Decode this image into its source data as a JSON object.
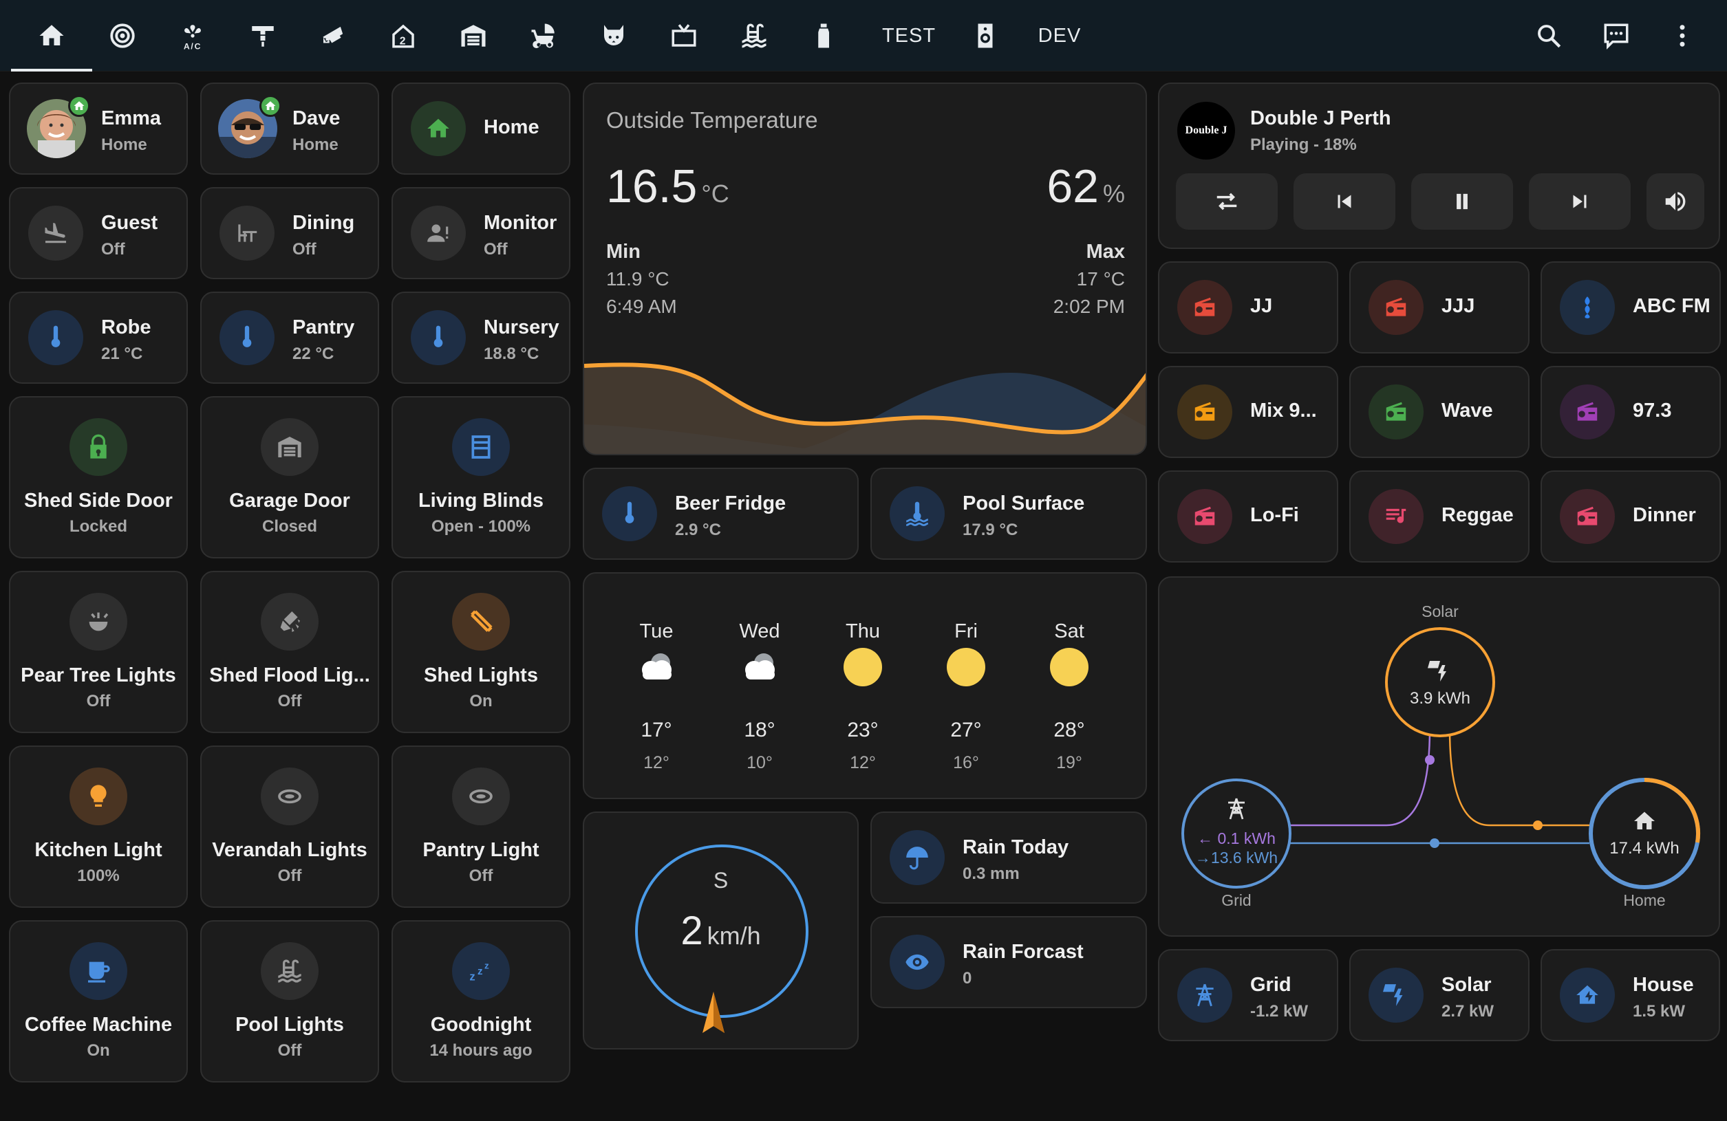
{
  "nav": {
    "tabs": [
      {
        "icon": "home-icon",
        "selected": true
      },
      {
        "icon": "camera-ring-icon"
      },
      {
        "icon": "air-conditioner-icon"
      },
      {
        "icon": "ceiling-fan-icon"
      },
      {
        "icon": "cctv-icon"
      },
      {
        "icon": "home-floor-2-icon"
      },
      {
        "icon": "garage-icon"
      },
      {
        "icon": "baby-carriage-icon"
      },
      {
        "icon": "cat-icon"
      },
      {
        "icon": "television-icon"
      },
      {
        "icon": "pool-icon"
      },
      {
        "icon": "spray-bottle-icon"
      },
      {
        "label": "TEST"
      },
      {
        "icon": "speaker-icon"
      },
      {
        "label": "DEV"
      }
    ],
    "test_label": "TEST",
    "dev_label": "DEV",
    "actions": [
      "search-icon",
      "assist-icon",
      "more-vertical-icon"
    ]
  },
  "persons": [
    {
      "name": "Emma",
      "state": "Home"
    },
    {
      "name": "Dave",
      "state": "Home"
    }
  ],
  "home_tile": {
    "name": "Home"
  },
  "tiles": {
    "guest": {
      "name": "Guest",
      "state": "Off"
    },
    "dining": {
      "name": "Dining",
      "state": "Off"
    },
    "monitor": {
      "name": "Monitor",
      "state": "Off"
    },
    "robe": {
      "name": "Robe",
      "state": "21 °C"
    },
    "pantry": {
      "name": "Pantry",
      "state": "22 °C"
    },
    "nursery": {
      "name": "Nursery",
      "state": "18.8 °C"
    },
    "shed_side_door": {
      "name": "Shed Side Door",
      "state": "Locked"
    },
    "garage_door": {
      "name": "Garage Door",
      "state": "Closed"
    },
    "living_blinds": {
      "name": "Living Blinds",
      "state": "Open - 100%"
    },
    "pear_tree": {
      "name": "Pear Tree Lights",
      "state": "Off"
    },
    "shed_flood": {
      "name": "Shed Flood Lig...",
      "state": "Off"
    },
    "shed_lights": {
      "name": "Shed Lights",
      "state": "On"
    },
    "kitchen_light": {
      "name": "Kitchen Light",
      "state": "100%"
    },
    "verandah": {
      "name": "Verandah Lights",
      "state": "Off"
    },
    "pantry_light": {
      "name": "Pantry Light",
      "state": "Off"
    },
    "coffee": {
      "name": "Coffee Machine",
      "state": "On"
    },
    "pool_lights": {
      "name": "Pool Lights",
      "state": "Off"
    },
    "goodnight": {
      "name": "Goodnight",
      "state": "14 hours ago"
    }
  },
  "outside": {
    "title": "Outside Temperature",
    "temp": "16.5",
    "temp_unit": "°C",
    "humidity": "62",
    "humidity_unit": "%",
    "min_label": "Min",
    "min_value": "11.9 °C",
    "min_time": "6:49 AM",
    "max_label": "Max",
    "max_value": "17 °C",
    "max_time": "2:02 PM"
  },
  "sensors": {
    "beer_fridge": {
      "name": "Beer Fridge",
      "state": "2.9 °C"
    },
    "pool_surface": {
      "name": "Pool Surface",
      "state": "17.9 °C"
    },
    "rain_today": {
      "name": "Rain Today",
      "state": "0.3 mm"
    },
    "rain_forecast": {
      "name": "Rain Forcast",
      "state": "0"
    }
  },
  "forecast": [
    {
      "day": "Tue",
      "high": "17°",
      "low": "12°",
      "condition": "cloudy"
    },
    {
      "day": "Wed",
      "high": "18°",
      "low": "10°",
      "condition": "cloudy"
    },
    {
      "day": "Thu",
      "high": "23°",
      "low": "12°",
      "condition": "sunny"
    },
    {
      "day": "Fri",
      "high": "27°",
      "low": "16°",
      "condition": "sunny"
    },
    {
      "day": "Sat",
      "high": "28°",
      "low": "19°",
      "condition": "sunny"
    }
  ],
  "wind": {
    "direction": "S",
    "speed": "2",
    "unit": "km/h"
  },
  "media": {
    "title": "Double J Perth",
    "status": "Playing - 18%",
    "logo_text": "Double J",
    "volume_percent": 18
  },
  "radio": [
    {
      "name": "JJ",
      "color": "#e74c3c"
    },
    {
      "name": "JJJ",
      "color": "#e74c3c"
    },
    {
      "name": "ABC FM",
      "color": "#2f80ed"
    },
    {
      "name": "Mix 9...",
      "color": "#f39c12"
    },
    {
      "name": "Wave",
      "color": "#4caf50"
    },
    {
      "name": "97.3",
      "color": "#a03fb5"
    },
    {
      "name": "Lo-Fi",
      "color": "#e84a6f"
    },
    {
      "name": "Reggae",
      "color": "#e84a6f"
    },
    {
      "name": "Dinner",
      "color": "#e84a6f"
    }
  ],
  "energy": {
    "solar_label": "Solar",
    "solar_value": "3.9 kWh",
    "grid_label": "Grid",
    "grid_in": "0.1 kWh",
    "grid_out": "13.6 kWh",
    "home_label": "Home",
    "home_value": "17.4 kWh"
  },
  "power": [
    {
      "name": "Grid",
      "state": "-1.2 kW"
    },
    {
      "name": "Solar",
      "state": "2.7 kW"
    },
    {
      "name": "House",
      "state": "1.5 kW"
    }
  ],
  "colors": {
    "background": "#111111",
    "card": "#1c1c1c",
    "solar": "#f7a134",
    "grid": "#5e96d6",
    "return": "#a779e0",
    "temp_line": "#f7a134"
  }
}
